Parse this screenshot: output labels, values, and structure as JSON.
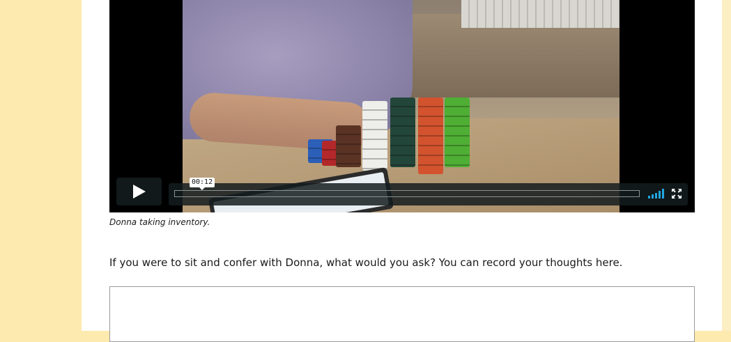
{
  "video": {
    "timecode": "00:12",
    "progress_fraction": 0.0,
    "controls": {
      "play_icon": "play-icon",
      "volume_icon": "volume-icon",
      "fullscreen_icon": "fullscreen-icon",
      "accent_color": "#1fa6e0"
    }
  },
  "caption": "Donna taking inventory.",
  "prompt": "If you were to sit and confer with Donna, what would you ask? You can record your thoughts here.",
  "answer": {
    "value": "",
    "placeholder": ""
  },
  "colors": {
    "page_background": "#fdeaae",
    "content_background": "#ffffff"
  }
}
